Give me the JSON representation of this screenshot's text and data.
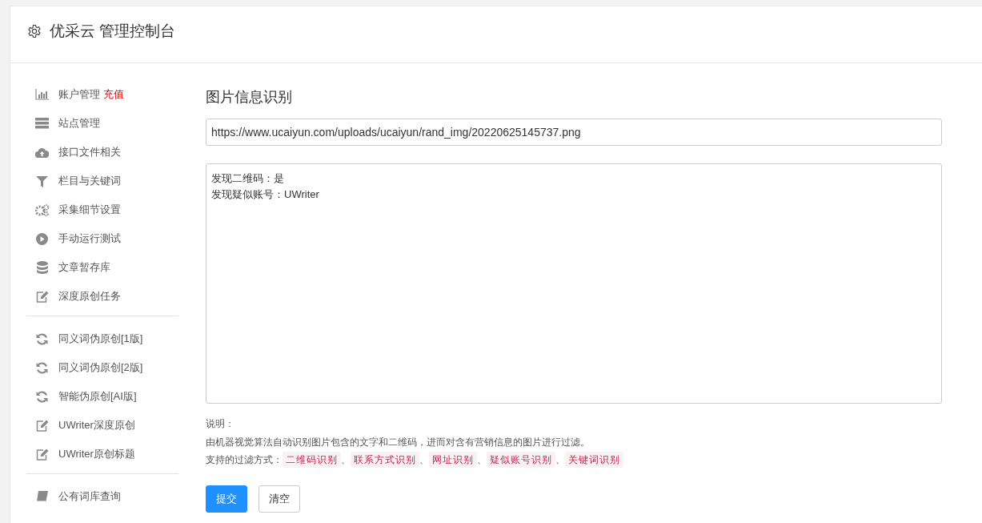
{
  "header": {
    "title": "优采云 管理控制台"
  },
  "sidebar": {
    "groups": [
      {
        "items": [
          {
            "label": "账户管理",
            "badge": "充值"
          },
          {
            "label": "站点管理"
          },
          {
            "label": "接口文件相关"
          },
          {
            "label": "栏目与关键词"
          },
          {
            "label": "采集细节设置"
          },
          {
            "label": "手动运行测试"
          },
          {
            "label": "文章暂存库"
          },
          {
            "label": "深度原创任务"
          }
        ]
      },
      {
        "items": [
          {
            "label": "同义词伪原创[1版]"
          },
          {
            "label": "同义词伪原创[2版]"
          },
          {
            "label": "智能伪原创[AI版]"
          },
          {
            "label": "UWriter深度原创"
          },
          {
            "label": "UWriter原创标题"
          }
        ]
      },
      {
        "items": [
          {
            "label": "公有词库查询"
          }
        ]
      }
    ]
  },
  "main": {
    "title": "图片信息识别",
    "url_field": {
      "value": "https://www.ucaiyun.com/uploads/ucaiyun/rand_img/20220625145737.png"
    },
    "result_field": {
      "lines": [
        "发现二维码：是",
        "发现疑似账号：UWriter"
      ]
    },
    "notes": {
      "heading": "说明：",
      "description": "由机器视觉算法自动识别图片包含的文字和二维码，进而对含有营销信息的图片进行过滤。",
      "filters_label": "支持的过滤方式：",
      "tags": [
        {
          "text": "二维码识别",
          "separator": "、"
        },
        {
          "text": "联系方式识别",
          "separator": "、"
        },
        {
          "text": "网址识别",
          "separator": "、"
        },
        {
          "text": "疑似账号识别",
          "separator": "、"
        },
        {
          "text": "关键词识别"
        }
      ]
    },
    "buttons": [
      {
        "label": "提交",
        "kind": "primary"
      },
      {
        "label": "清空",
        "kind": "default"
      }
    ]
  }
}
